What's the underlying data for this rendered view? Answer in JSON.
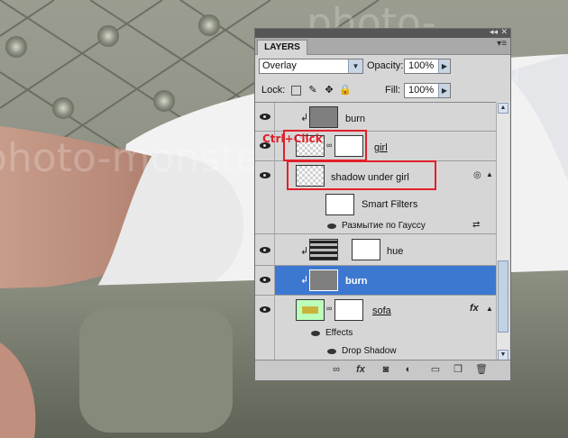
{
  "watermark": "photo-monster.ru",
  "panel": {
    "tab_label": "LAYERS",
    "blend_mode": "Overlay",
    "opacity_label": "Opacity:",
    "opacity_value": "100%",
    "lock_label": "Lock:",
    "fill_label": "Fill:",
    "fill_value": "100%"
  },
  "layers": [
    {
      "name": "burn"
    },
    {
      "name": "girl"
    },
    {
      "name": "shadow under girl"
    },
    {
      "name": "Smart Filters"
    },
    {
      "name": "Размытие по Гауссу"
    },
    {
      "name": "hue"
    },
    {
      "name": "burn"
    },
    {
      "name": "sofa"
    },
    {
      "name": "Effects"
    },
    {
      "name": "Drop Shadow"
    }
  ],
  "fx_label": "fx",
  "annotation": {
    "text": "Ctrl+Click",
    "color": "#e0202a"
  },
  "colors": {
    "selected_row": "#3c78d0",
    "panel_bg": "#d6d6d6"
  }
}
